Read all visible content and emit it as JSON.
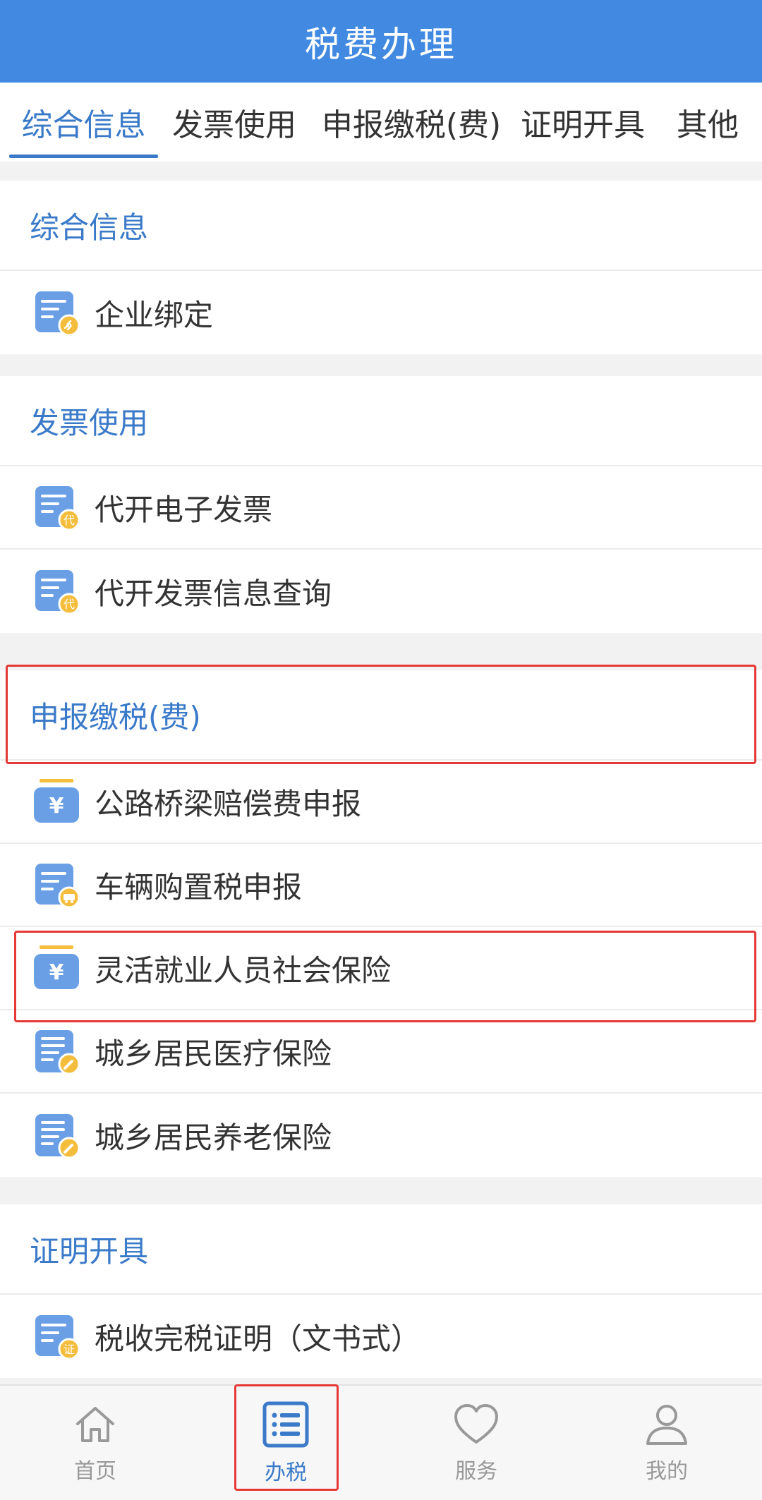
{
  "header": {
    "title": "税费办理"
  },
  "tabs": [
    {
      "label": "综合信息",
      "active": true
    },
    {
      "label": "发票使用"
    },
    {
      "label": "申报缴税(费)"
    },
    {
      "label": "证明开具"
    },
    {
      "label": "其他"
    }
  ],
  "sections": {
    "info": {
      "title": "综合信息",
      "items": [
        {
          "label": "企业绑定",
          "icon": "doc-link-icon"
        }
      ]
    },
    "invoice": {
      "title": "发票使用",
      "items": [
        {
          "label": "代开电子发票",
          "icon": "doc-dai-icon"
        },
        {
          "label": "代开发票信息查询",
          "icon": "doc-dai-icon"
        }
      ]
    },
    "declare": {
      "title": "申报缴税(费)",
      "items": [
        {
          "label": "公路桥梁赔偿费申报",
          "icon": "yuan-icon"
        },
        {
          "label": "车辆购置税申报",
          "icon": "doc-car-icon"
        },
        {
          "label": "灵活就业人员社会保险",
          "icon": "yuan-icon"
        },
        {
          "label": "城乡居民医疗保险",
          "icon": "doc-pen-icon"
        },
        {
          "label": "城乡居民养老保险",
          "icon": "doc-pen-icon"
        }
      ]
    },
    "cert": {
      "title": "证明开具",
      "items": [
        {
          "label": "税收完税证明（文书式）",
          "icon": "doc-zheng-icon"
        }
      ]
    }
  },
  "icon_badges": {
    "dai": "代",
    "zheng": "证",
    "yuan": "¥"
  },
  "bottom_nav": [
    {
      "label": "首页",
      "icon": "home-icon"
    },
    {
      "label": "办税",
      "icon": "list-icon",
      "active": true
    },
    {
      "label": "服务",
      "icon": "heart-icon"
    },
    {
      "label": "我的",
      "icon": "user-icon"
    }
  ],
  "colors": {
    "primary": "#4189e1",
    "accent_text": "#3a7ac9",
    "icon_blue": "#6a9fe6",
    "icon_badge": "#f5bd3c",
    "highlight": "#e53935"
  }
}
